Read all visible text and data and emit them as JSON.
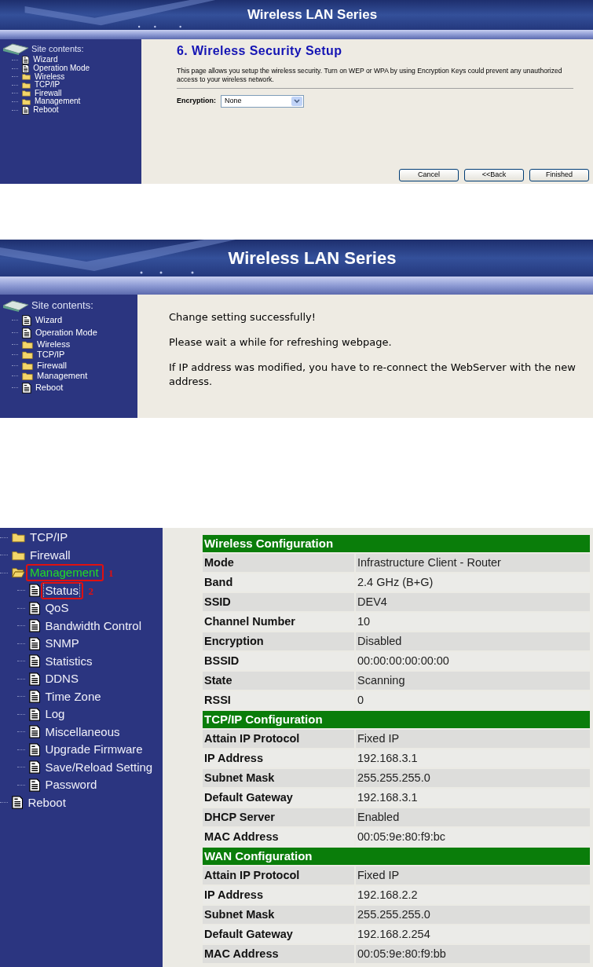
{
  "screens": [
    {
      "kind": "wizard",
      "header": {
        "title": "Wireless LAN Series"
      },
      "sidebar": {
        "title": "Site contents:",
        "items": [
          {
            "label": "Wizard",
            "kind": "page"
          },
          {
            "label": "Operation Mode",
            "kind": "page"
          },
          {
            "label": "Wireless",
            "kind": "folder"
          },
          {
            "label": "TCP/IP",
            "kind": "folder"
          },
          {
            "label": "Firewall",
            "kind": "folder"
          },
          {
            "label": "Management",
            "kind": "folder"
          },
          {
            "label": "Reboot",
            "kind": "page"
          }
        ]
      },
      "heading": "6. Wireless Security Setup",
      "description": "This page allows you setup the wireless security. Turn on WEP or WPA by using Encryption Keys could prevent any unauthorized access to your wireless network.",
      "field": {
        "label": "Encryption:",
        "value": "None"
      },
      "buttons": [
        "Cancel",
        "<<Back",
        "Finished"
      ]
    },
    {
      "kind": "message",
      "header": {
        "title": "Wireless LAN Series"
      },
      "sidebar": {
        "title": "Site contents:",
        "items": [
          {
            "label": "Wizard",
            "kind": "page"
          },
          {
            "label": "Operation Mode",
            "kind": "page"
          },
          {
            "label": "Wireless",
            "kind": "folder"
          },
          {
            "label": "TCP/IP",
            "kind": "folder"
          },
          {
            "label": "Firewall",
            "kind": "folder"
          },
          {
            "label": "Management",
            "kind": "folder"
          },
          {
            "label": "Reboot",
            "kind": "page"
          }
        ]
      },
      "messages": [
        "Change setting successfully!",
        "Please wait a while for refreshing webpage.",
        "If IP address was modified, you have to re-connect the WebServer with the new address."
      ]
    },
    {
      "kind": "status",
      "tree": [
        {
          "label": "TCP/IP",
          "kind": "folder",
          "selected": false
        },
        {
          "label": "Firewall",
          "kind": "folder",
          "selected": false
        },
        {
          "label": "Management",
          "kind": "open-folder",
          "selected": true,
          "callout": "1",
          "children": [
            {
              "label": "Status",
              "kind": "page",
              "focused": true,
              "callout": "2"
            },
            {
              "label": "QoS",
              "kind": "page",
              "focused": false
            },
            {
              "label": "Bandwidth Control",
              "kind": "page",
              "focused": false
            },
            {
              "label": "SNMP",
              "kind": "page",
              "focused": false
            },
            {
              "label": "Statistics",
              "kind": "page",
              "focused": false
            },
            {
              "label": "DDNS",
              "kind": "page",
              "focused": false
            },
            {
              "label": "Time Zone",
              "kind": "page",
              "focused": false
            },
            {
              "label": "Log",
              "kind": "page",
              "focused": false
            },
            {
              "label": "Miscellaneous",
              "kind": "page",
              "focused": false
            },
            {
              "label": "Upgrade Firmware",
              "kind": "page",
              "focused": false
            },
            {
              "label": "Save/Reload Setting",
              "kind": "page",
              "focused": false
            },
            {
              "label": "Password",
              "kind": "page",
              "focused": false
            }
          ]
        },
        {
          "label": "Reboot",
          "kind": "page",
          "selected": false
        }
      ],
      "sections": [
        {
          "title": "Wireless Configuration",
          "rows": [
            {
              "label": "Mode",
              "value": "Infrastructure Client - Router"
            },
            {
              "label": "Band",
              "value": "2.4 GHz (B+G)"
            },
            {
              "label": "SSID",
              "value": "DEV4"
            },
            {
              "label": "Channel Number",
              "value": "10"
            },
            {
              "label": "Encryption",
              "value": "Disabled"
            },
            {
              "label": "BSSID",
              "value": "00:00:00:00:00:00"
            },
            {
              "label": "State",
              "value": "Scanning"
            },
            {
              "label": "RSSI",
              "value": "0"
            }
          ]
        },
        {
          "title": "TCP/IP Configuration",
          "rows": [
            {
              "label": "Attain IP Protocol",
              "value": "Fixed IP"
            },
            {
              "label": "IP Address",
              "value": "192.168.3.1"
            },
            {
              "label": "Subnet Mask",
              "value": "255.255.255.0"
            },
            {
              "label": "Default Gateway",
              "value": "192.168.3.1"
            },
            {
              "label": "DHCP Server",
              "value": "Enabled"
            },
            {
              "label": "MAC Address",
              "value": "00:05:9e:80:f9:bc"
            }
          ]
        },
        {
          "title": "WAN Configuration",
          "rows": [
            {
              "label": "Attain IP Protocol",
              "value": "Fixed IP"
            },
            {
              "label": "IP Address",
              "value": "192.168.2.2"
            },
            {
              "label": "Subnet Mask",
              "value": "255.255.255.0"
            },
            {
              "label": "Default Gateway",
              "value": "192.168.2.254"
            },
            {
              "label": "MAC Address",
              "value": "00:05:9e:80:f9:bb"
            }
          ]
        }
      ]
    }
  ]
}
